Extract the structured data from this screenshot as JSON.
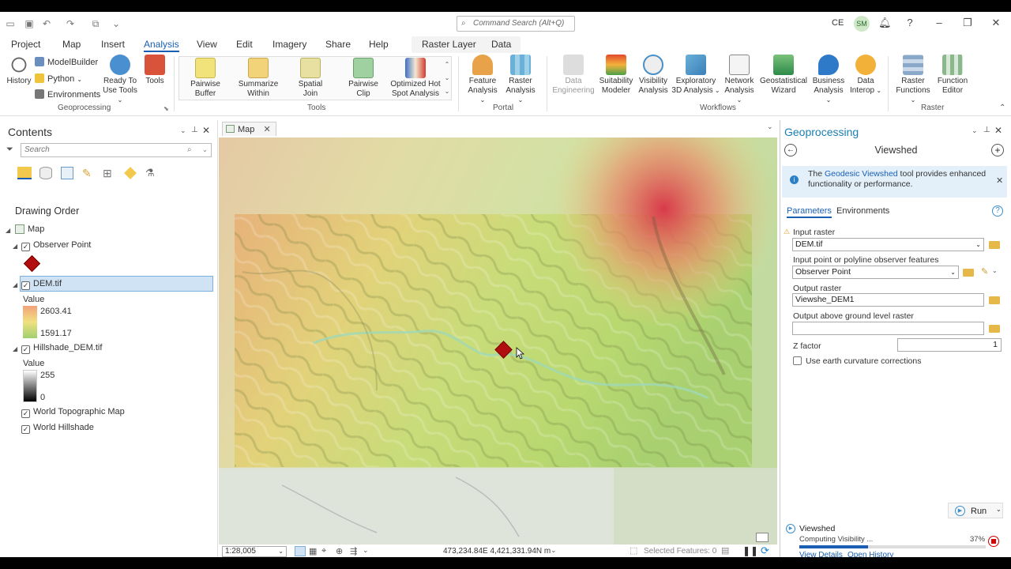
{
  "titlebar": {
    "command_search_placeholder": "Command Search (Alt+Q)",
    "user_initials_text": "CE",
    "avatar_initials": "SM",
    "help": "?"
  },
  "tabs": [
    "Project",
    "Map",
    "Insert",
    "Analysis",
    "View",
    "Edit",
    "Imagery",
    "Share",
    "Help"
  ],
  "active_tab": "Analysis",
  "context_tabs": [
    "Raster Layer",
    "Data"
  ],
  "ribbon": {
    "geoprocessing": {
      "history": "History",
      "modelbuilder": "ModelBuilder",
      "python": "Python",
      "environments": "Environments",
      "ready_to_use_line1": "Ready To",
      "ready_to_use_line2": "Use Tools",
      "tools": "Tools",
      "group_label": "Geoprocessing"
    },
    "tools_gallery": {
      "items": [
        {
          "line1": "Pairwise",
          "line2": "Buffer"
        },
        {
          "line1": "Summarize",
          "line2": "Within"
        },
        {
          "line1": "Spatial",
          "line2": "Join"
        },
        {
          "line1": "Pairwise",
          "line2": "Clip"
        },
        {
          "line1": "Optimized Hot",
          "line2": "Spot Analysis"
        }
      ],
      "group_label": "Tools"
    },
    "portal": {
      "feature_line1": "Feature",
      "feature_line2": "Analysis",
      "raster_line1": "Raster",
      "raster_line2": "Analysis",
      "group_label": "Portal"
    },
    "workflows": {
      "items": [
        {
          "line1": "Data",
          "line2": "Engineering"
        },
        {
          "line1": "Suitability",
          "line2": "Modeler"
        },
        {
          "line1": "Visibility",
          "line2": "Analysis"
        },
        {
          "line1": "Exploratory",
          "line2": "3D Analysis"
        },
        {
          "line1": "Network",
          "line2": "Analysis"
        },
        {
          "line1": "Geostatistical",
          "line2": "Wizard"
        },
        {
          "line1": "Business",
          "line2": "Analysis"
        },
        {
          "line1": "Data",
          "line2": "Interop"
        }
      ],
      "group_label": "Workflows"
    },
    "raster": {
      "functions_line1": "Raster",
      "functions_line2": "Functions",
      "editor_line1": "Function",
      "editor_line2": "Editor",
      "group_label": "Raster"
    }
  },
  "contents": {
    "title": "Contents",
    "search_placeholder": "Search",
    "drawing_order": "Drawing Order",
    "map_name": "Map",
    "layers": {
      "observer": "Observer Point",
      "dem": "DEM.tif",
      "dem_value_label": "Value",
      "dem_high": "2603.41",
      "dem_low": "1591.17",
      "hillshade": "Hillshade_DEM.tif",
      "hill_value_label": "Value",
      "hill_high": "255",
      "hill_low": "0",
      "topo": "World Topographic Map",
      "world_hillshade": "World Hillshade"
    }
  },
  "map": {
    "tab_label": "Map",
    "scale": "1:28,005",
    "coordinates": "473,234.84E 4,421,331.94N m",
    "selected_features": "Selected Features: 0"
  },
  "geoprocessing": {
    "pane_title": "Geoprocessing",
    "tool_title": "Viewshed",
    "info_prefix": "The ",
    "info_link": "Geodesic Viewshed",
    "info_suffix": " tool provides enhanced functionality or performance.",
    "tab_parameters": "Parameters",
    "tab_environments": "Environments",
    "input_raster_label": "Input raster",
    "input_raster_value": "DEM.tif",
    "observer_label": "Input point or polyline observer features",
    "observer_value": "Observer Point",
    "output_raster_label": "Output raster",
    "output_raster_value": "Viewshe_DEM1",
    "agl_label": "Output above ground level raster",
    "agl_value": "",
    "zfactor_label": "Z factor",
    "zfactor_value": "1",
    "curvature_label": "Use earth curvature corrections",
    "run_label": "Run",
    "progress_tool": "Viewshed",
    "progress_message": "Computing Visibility ...",
    "progress_percent_text": "37%",
    "progress_fraction": 0.37,
    "view_details": "View Details",
    "open_history": "Open History"
  },
  "colors": {
    "accent": "#1a5fb4",
    "observer_marker": "#b10f0f",
    "progress_fill": "#1a5fb4"
  }
}
